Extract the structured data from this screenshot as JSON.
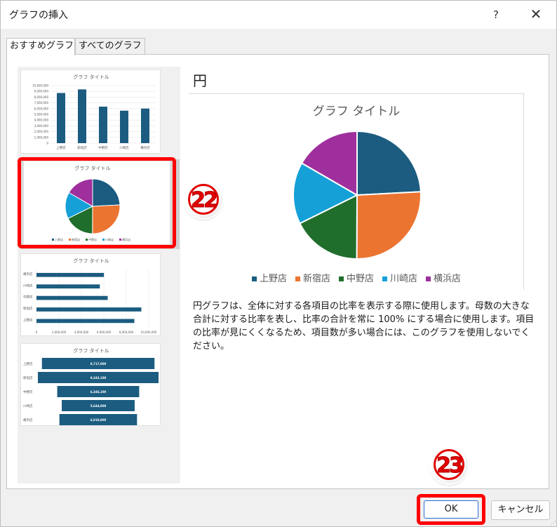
{
  "window": {
    "title": "グラフの挿入",
    "help_label": "?",
    "close_label": "✕"
  },
  "tabs": [
    {
      "label": "おすすめグラフ",
      "active": true
    },
    {
      "label": "すべてのグラフ",
      "active": false
    }
  ],
  "thumbnails": {
    "title": "グラフ タイトル",
    "categories": [
      "上野店",
      "新宿店",
      "中野店",
      "川崎店",
      "横浜店"
    ],
    "column_axis": [
      "10,000,000",
      "9,000,000",
      "8,000,000",
      "7,000,000",
      "6,000,000",
      "5,000,000",
      "4,000,000",
      "3,000,000",
      "2,000,000",
      "1,000,000",
      "0"
    ],
    "bar_axis": [
      "0",
      "2,000,000",
      "4,000,000",
      "6,000,000",
      "8,000,000",
      "10,000,000"
    ],
    "bar_order": [
      "横浜店",
      "川崎店",
      "中野店",
      "新宿店",
      "上野店"
    ],
    "funnel_labels": [
      "8,717,800",
      "9,343,100",
      "6,346,100",
      "5,644,800",
      "6,010,800"
    ]
  },
  "preview": {
    "type_name": "円",
    "description": "円グラフは、全体に対する各項目の比率を表示する際に使用します。母数の大きな合計に対する比率を表し、比率の合計を常に 100% にする場合に使用します。項目の比率が見にくくなるため、項目数が多い場合には、このグラフを使用しないでください。"
  },
  "chart_data": {
    "type": "pie",
    "title": "グラフ タイトル",
    "categories": [
      "上野店",
      "新宿店",
      "中野店",
      "川崎店",
      "横浜店"
    ],
    "values": [
      8717800,
      9343100,
      6346100,
      5644800,
      6010800
    ],
    "colors": [
      "#1b5c80",
      "#ec7431",
      "#1f6e2b",
      "#15a0d8",
      "#9f2f9d"
    ],
    "legend_position": "bottom"
  },
  "annotations": {
    "step_22": "22",
    "step_23": "23",
    "highlight_color": "#ff0000"
  },
  "buttons": {
    "ok_label": "OK",
    "cancel_label": "キャンセル"
  }
}
